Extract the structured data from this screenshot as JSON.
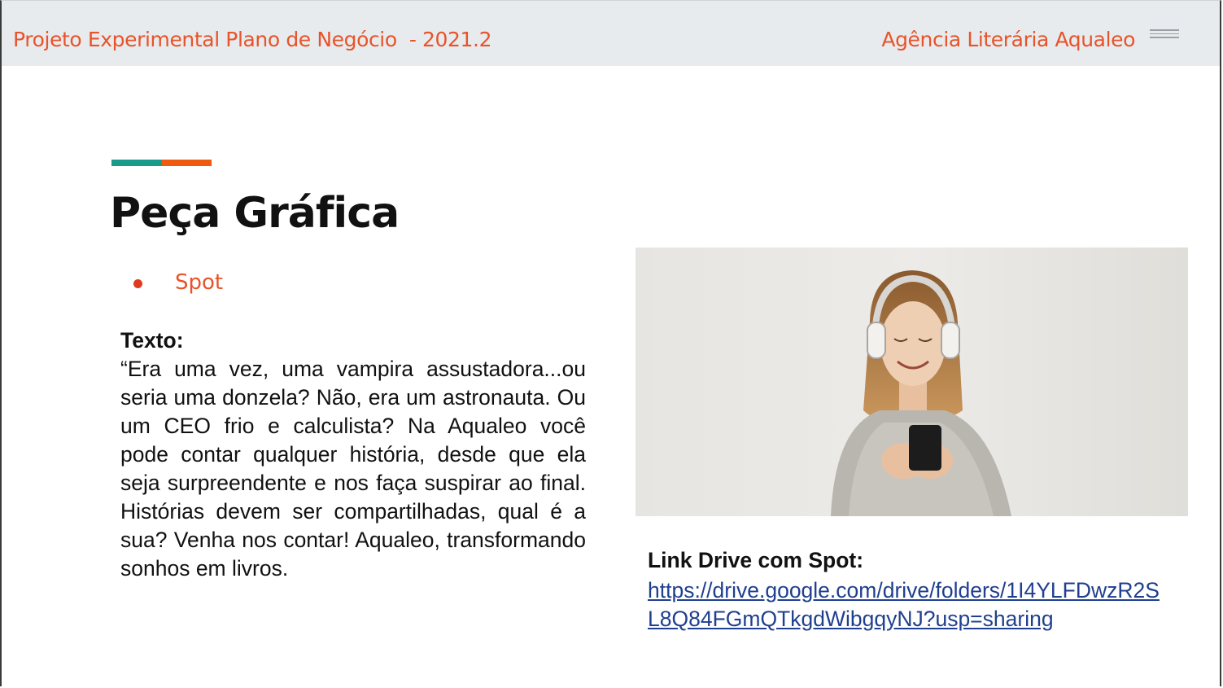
{
  "header": {
    "title": "Projeto Experimental Plano de Negócio  - 2021.2",
    "brand": "Agência Literária Aqualeo",
    "menu_icon": "hamburger-menu-icon"
  },
  "colors": {
    "accent_teal": "#1a9a8a",
    "accent_orange": "#ee5a10",
    "title_orange": "#e8532a",
    "link_blue": "#1f3f8f"
  },
  "slide": {
    "heading": "Peça Gráfica",
    "bullet": "Spot",
    "text_label": "Texto:",
    "text_body": "“Era uma vez, uma vampira assustadora...ou seria uma donzela?  Não, era um astronauta. Ou um CEO frio e calculista? Na Aqualeo você pode contar qualquer história, desde que ela seja surpreendente e nos faça suspirar ao final. Histórias devem ser compartilhadas, qual é a sua? Venha nos contar! Aqualeo, transformando sonhos em livros.",
    "link_label": "Link Drive com Spot:",
    "link_url": "https://drive.google.com/drive/folders/1I4YLFDwzR2SL8Q84FGmQTkgdWibgqyNJ?usp=sharing",
    "image": "woman-with-headphones-smartphone-photo"
  }
}
